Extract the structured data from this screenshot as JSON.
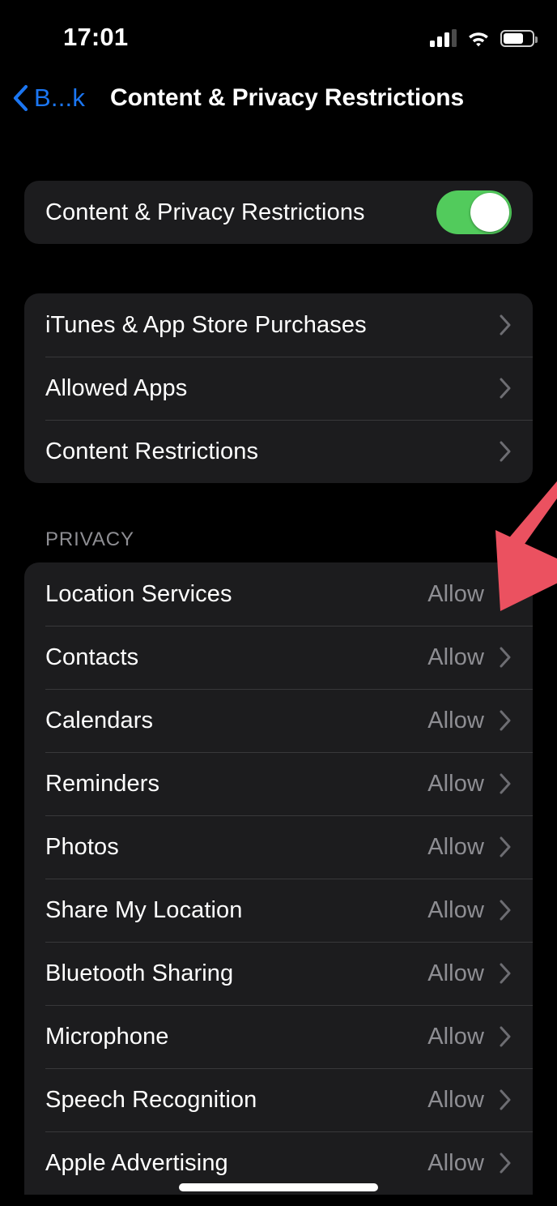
{
  "statusbar": {
    "time": "17:01",
    "cellular_icon": "cellular-signal-icon",
    "wifi_icon": "wifi-icon",
    "battery_icon": "battery-icon",
    "signal_bars_filled": 3,
    "signal_bars_total": 4,
    "battery_percent": 70
  },
  "navbar": {
    "back_label": "B...k",
    "back_icon": "chevron-left-icon",
    "title": "Content & Privacy Restrictions"
  },
  "toggle_section": {
    "label": "Content & Privacy Restrictions",
    "value": "on",
    "accent_color": "#52CB5C"
  },
  "links_section": {
    "items": [
      {
        "label": "iTunes & App Store Purchases"
      },
      {
        "label": "Allowed Apps"
      },
      {
        "label": "Content Restrictions"
      }
    ]
  },
  "privacy_section": {
    "header": "PRIVACY",
    "items": [
      {
        "label": "Location Services",
        "value": "Allow"
      },
      {
        "label": "Contacts",
        "value": "Allow"
      },
      {
        "label": "Calendars",
        "value": "Allow"
      },
      {
        "label": "Reminders",
        "value": "Allow"
      },
      {
        "label": "Photos",
        "value": "Allow"
      },
      {
        "label": "Share My Location",
        "value": "Allow"
      },
      {
        "label": "Bluetooth Sharing",
        "value": "Allow"
      },
      {
        "label": "Microphone",
        "value": "Allow"
      },
      {
        "label": "Speech Recognition",
        "value": "Allow"
      },
      {
        "label": "Apple Advertising",
        "value": "Allow"
      }
    ]
  },
  "annotation": {
    "icon": "red-arrow-annotation",
    "color": "#EB5160",
    "points_to": "Location Services"
  },
  "home_indicator": {
    "icon": "home-indicator"
  },
  "colors": {
    "background": "#000000",
    "card": "#1C1C1E",
    "divider": "#38383A",
    "primary_text": "#FFFFFF",
    "secondary_text": "#8E8E93",
    "tint": "#1B76F2"
  }
}
